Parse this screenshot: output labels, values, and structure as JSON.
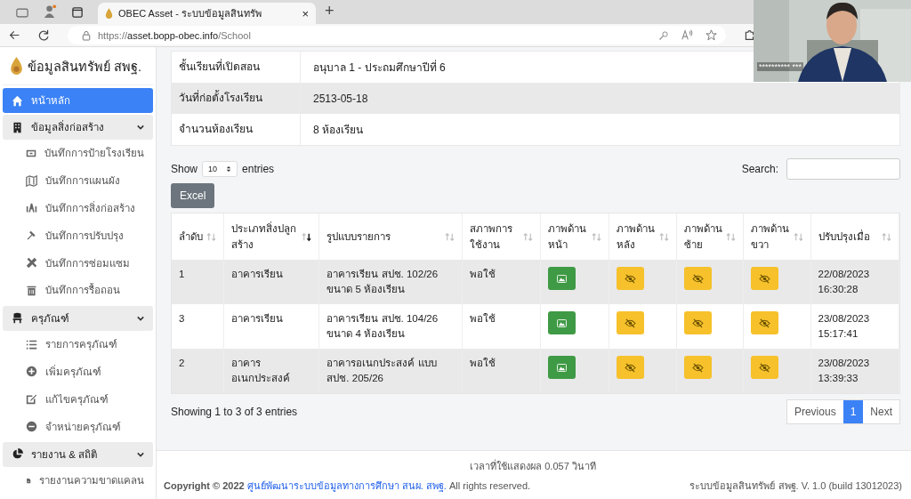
{
  "browser": {
    "tab": {
      "title": "OBEC Asset - ระบบข้อมูลสินทรัพ",
      "close": "×"
    },
    "new_tab": "+",
    "url": {
      "scheme": "https://",
      "host": "asset.bopp-obec.info",
      "path": "/School"
    }
  },
  "video": {
    "name": "********** ***"
  },
  "sidebar": {
    "brand": "ข้อมูลสินทรัพย์ สพฐ.",
    "items": [
      {
        "kind": "link",
        "label": "หน้าหลัก",
        "selected": true
      },
      {
        "kind": "section",
        "label": "ข้อมูลสิ่งก่อสร้าง",
        "expanded": true,
        "children": [
          {
            "label": "บันทึกการป้ายโรงเรียน"
          },
          {
            "label": "บันทึกการแผนผัง"
          },
          {
            "label": "บันทึกการสิ่งก่อสร้าง"
          },
          {
            "label": "บันทึกการปรับปรุง"
          },
          {
            "label": "บันทึกการซ่อมแซม"
          },
          {
            "label": "บันทึกการรื้อถอน"
          }
        ]
      },
      {
        "kind": "section",
        "label": "ครุภัณฑ์",
        "expanded": true,
        "children": [
          {
            "label": "รายการครุภัณฑ์"
          },
          {
            "label": "เพิ่มครุภัณฑ์"
          },
          {
            "label": "แก้ไขครุภัณฑ์"
          },
          {
            "label": "จำหน่ายครุภัณฑ์"
          }
        ]
      },
      {
        "kind": "section",
        "label": "รายงาน & สถิติ",
        "expanded": true,
        "children": [
          {
            "label": "รายงานความขาดแคลน"
          }
        ]
      }
    ]
  },
  "details": [
    {
      "label": "ชั้นเรียนที่เปิดสอน",
      "value": "อนุบาล 1 - ประถมศึกษาปีที่ 6"
    },
    {
      "label": "วันที่ก่อตั้งโรงเรียน",
      "value": "2513-05-18"
    },
    {
      "label": "จำนวนห้องเรียน",
      "value": "8 ห้องเรียน"
    }
  ],
  "length": {
    "prefix": "Show",
    "value": "10",
    "suffix": "entries"
  },
  "search": {
    "label": "Search:"
  },
  "excel_button": "Excel",
  "table": {
    "columns": [
      {
        "label": "ลำดับ",
        "sorted": false
      },
      {
        "label": "ประเภทสิ่งปลูกสร้าง",
        "sorted": true
      },
      {
        "label": "รูปแบบรายการ",
        "sorted": false
      },
      {
        "label": "สภาพการใช้งาน",
        "sorted": false
      },
      {
        "label": "ภาพด้านหน้า",
        "sorted": false
      },
      {
        "label": "ภาพด้านหลัง",
        "sorted": false
      },
      {
        "label": "ภาพด้านซ้าย",
        "sorted": false
      },
      {
        "label": "ภาพด้านขวา",
        "sorted": false
      },
      {
        "label": "ปรับปรุงเมื่อ",
        "sorted": false
      }
    ],
    "rows": [
      {
        "no": "1",
        "type": "อาคารเรียน",
        "model": "อาคารเรียน สปช. 102/26 ขนาด 5 ห้องเรียน",
        "condition": "พอใช้",
        "photos": [
          {
            "available": true
          },
          {
            "available": false
          },
          {
            "available": false
          },
          {
            "available": false
          }
        ],
        "updated": "22/08/2023 16:30:28"
      },
      {
        "no": "3",
        "type": "อาคารเรียน",
        "model": "อาคารเรียน สปช. 104/26 ขนาด 4 ห้องเรียน",
        "condition": "พอใช้",
        "photos": [
          {
            "available": true
          },
          {
            "available": false
          },
          {
            "available": false
          },
          {
            "available": false
          }
        ],
        "updated": "23/08/2023 15:17:41"
      },
      {
        "no": "2",
        "type": "อาคาร อเนกประสงค์",
        "model": "อาคารอเนกประสงค์ แบบ สปช. 205/26",
        "condition": "พอใช้",
        "photos": [
          {
            "available": true
          },
          {
            "available": false
          },
          {
            "available": false
          },
          {
            "available": false
          }
        ],
        "updated": "23/08/2023 13:39:33"
      }
    ]
  },
  "info": "Showing 1 to 3 of 3 entries",
  "pagination": [
    {
      "label": "Previous",
      "selected": false
    },
    {
      "label": "1",
      "selected": true
    },
    {
      "label": "Next",
      "selected": false
    }
  ],
  "footer": {
    "timing": "เวลาที่ใช้แสดงผล 0.057 วินาที",
    "copyright": "**Copyright © 2022**",
    "link": "ศูนย์พัฒนาระบบข้อมูลทางการศึกษา สนผ. สพฐ.",
    "rights": "All rights reserved.",
    "version": "ระบบข้อมูลสินทรัพย์ สพฐ. V. 1.0 (build 13012023)"
  }
}
